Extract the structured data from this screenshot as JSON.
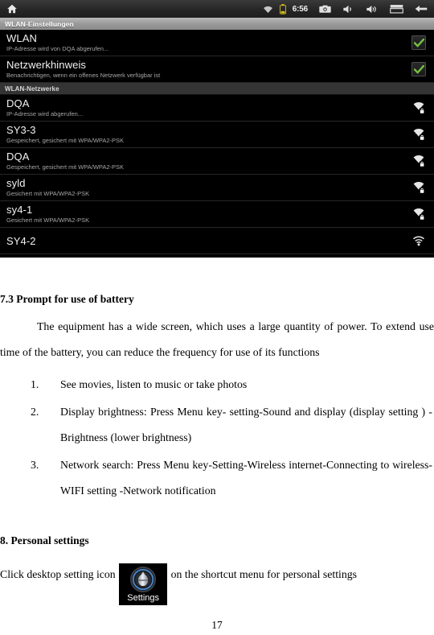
{
  "android": {
    "statusbar": {
      "home_icon": "home-icon",
      "wifi_icon": "wifi-icon",
      "battery_icon": "battery-icon",
      "time": "6:56",
      "camera_icon": "camera-icon",
      "volume_down_icon": "volume-down-icon",
      "volume_up_icon": "volume-up-icon",
      "recent_apps_icon": "recent-apps-icon",
      "back_icon": "back-arrow-icon"
    },
    "title": "WLAN-Einstellungen",
    "wlan_toggle": {
      "title": "WLAN",
      "subtitle": "IP-Adresse wird von DQA abgerufen...",
      "checked": true
    },
    "notify_toggle": {
      "title": "Netzwerkhinweis",
      "subtitle": "Benachrichtigen, wenn ein offenes Netzwerk verfügbar ist",
      "checked": true
    },
    "networks_header": "WLAN-Netzwerke",
    "networks": [
      {
        "ssid": "DQA",
        "status": "IP-Adresse wird abgerufen...",
        "secured": true
      },
      {
        "ssid": "SY3-3",
        "status": "Gespeichert, gesichert mit WPA/WPA2-PSK",
        "secured": true
      },
      {
        "ssid": "DQA",
        "status": "Gespeichert, gesichert mit WPA/WPA2-PSK",
        "secured": true
      },
      {
        "ssid": "syld",
        "status": "Gesichert mit WPA/WPA2-PSK",
        "secured": true
      },
      {
        "ssid": "sy4-1",
        "status": "Gesichert mit WPA/WPA2-PSK",
        "secured": true
      },
      {
        "ssid": "SY4-2",
        "status": "",
        "secured": false
      }
    ],
    "colors": {
      "check_green": "#76c043",
      "battery_yellow": "#e3c000",
      "background": "#000000",
      "section_header_bg": "#343434"
    }
  },
  "document": {
    "heading_73": "7.3 Prompt for use of battery",
    "para_1": "The equipment has a wide screen, which uses a large quantity of power. To extend use time of the battery, you can reduce the frequency for use of its functions",
    "list": [
      {
        "num": "1.",
        "text": "See movies, listen to music or take photos"
      },
      {
        "num": "2.",
        "text": "Display brightness: Press Menu key- setting-Sound and display (display setting ) -Brightness (lower brightness)"
      },
      {
        "num": "3.",
        "text": "Network search: Press Menu key-Setting-Wireless internet-Connecting to wireless-WIFI setting -Network notification"
      }
    ],
    "heading_8": "8. Personal settings",
    "settings_line_before": "Click desktop setting icon",
    "settings_icon_label": "Settings",
    "settings_line_after": "on the shortcut menu for personal settings",
    "page_number": "17"
  }
}
